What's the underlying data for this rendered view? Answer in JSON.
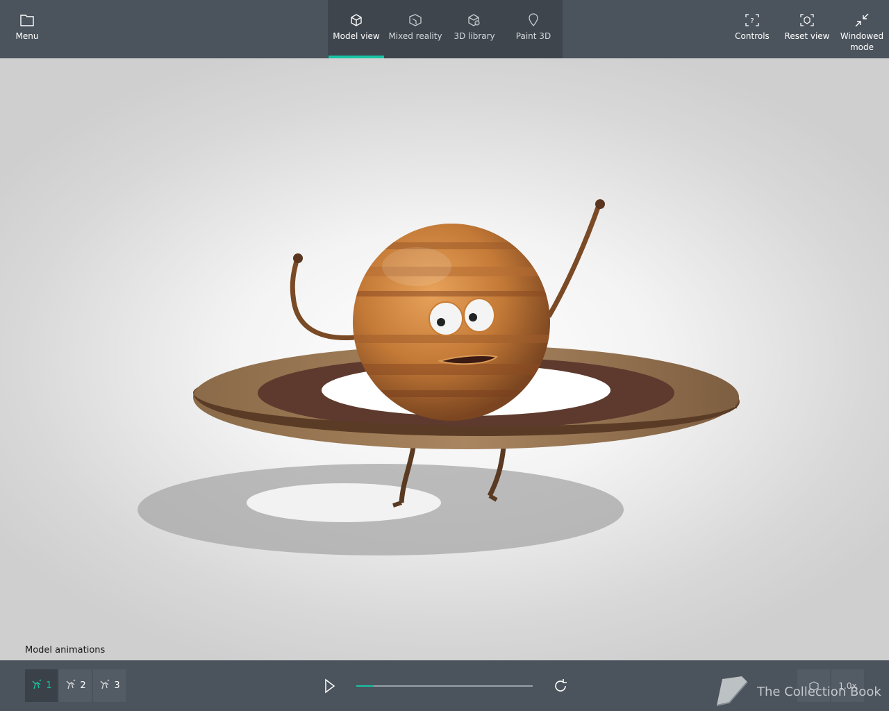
{
  "topbar": {
    "menu_label": "Menu",
    "tabs": [
      {
        "label": "Model view",
        "icon": "cube-icon",
        "active": true
      },
      {
        "label": "Mixed reality",
        "icon": "mixed-reality-icon",
        "active": false
      },
      {
        "label": "3D library",
        "icon": "3d-library-icon",
        "active": false
      },
      {
        "label": "Paint 3D",
        "icon": "paint-3d-icon",
        "active": false
      }
    ],
    "right_actions": [
      {
        "label": "Controls",
        "icon": "controls-icon"
      },
      {
        "label": "Reset view",
        "icon": "reset-view-icon"
      },
      {
        "label": "Windowed mode",
        "icon": "windowed-mode-icon"
      }
    ]
  },
  "viewport": {
    "model": "Cartoon ringed planet character"
  },
  "animations": {
    "label": "Model animations",
    "items": [
      "1",
      "2",
      "3"
    ],
    "active_index": 0,
    "progress": 0.1
  },
  "bottom_controls": {
    "speed_label": "1.0x"
  },
  "watermark": {
    "text": "The Collection Book"
  },
  "colors": {
    "accent": "#19c4a6",
    "bar": "#4b535c",
    "tab_bg": "#3e454d"
  }
}
